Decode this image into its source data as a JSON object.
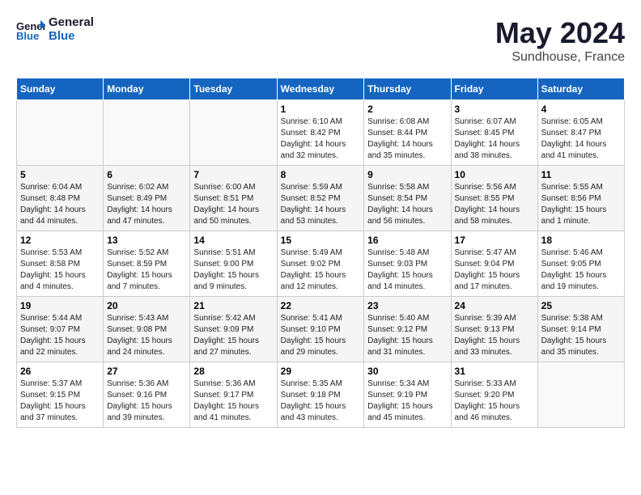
{
  "header": {
    "logo_line1": "General",
    "logo_line2": "Blue",
    "month_title": "May 2024",
    "subtitle": "Sundhouse, France"
  },
  "days_of_week": [
    "Sunday",
    "Monday",
    "Tuesday",
    "Wednesday",
    "Thursday",
    "Friday",
    "Saturday"
  ],
  "weeks": [
    [
      {
        "day": "",
        "sunrise": "",
        "sunset": "",
        "daylight": ""
      },
      {
        "day": "",
        "sunrise": "",
        "sunset": "",
        "daylight": ""
      },
      {
        "day": "",
        "sunrise": "",
        "sunset": "",
        "daylight": ""
      },
      {
        "day": "1",
        "sunrise": "Sunrise: 6:10 AM",
        "sunset": "Sunset: 8:42 PM",
        "daylight": "Daylight: 14 hours and 32 minutes."
      },
      {
        "day": "2",
        "sunrise": "Sunrise: 6:08 AM",
        "sunset": "Sunset: 8:44 PM",
        "daylight": "Daylight: 14 hours and 35 minutes."
      },
      {
        "day": "3",
        "sunrise": "Sunrise: 6:07 AM",
        "sunset": "Sunset: 8:45 PM",
        "daylight": "Daylight: 14 hours and 38 minutes."
      },
      {
        "day": "4",
        "sunrise": "Sunrise: 6:05 AM",
        "sunset": "Sunset: 8:47 PM",
        "daylight": "Daylight: 14 hours and 41 minutes."
      }
    ],
    [
      {
        "day": "5",
        "sunrise": "Sunrise: 6:04 AM",
        "sunset": "Sunset: 8:48 PM",
        "daylight": "Daylight: 14 hours and 44 minutes."
      },
      {
        "day": "6",
        "sunrise": "Sunrise: 6:02 AM",
        "sunset": "Sunset: 8:49 PM",
        "daylight": "Daylight: 14 hours and 47 minutes."
      },
      {
        "day": "7",
        "sunrise": "Sunrise: 6:00 AM",
        "sunset": "Sunset: 8:51 PM",
        "daylight": "Daylight: 14 hours and 50 minutes."
      },
      {
        "day": "8",
        "sunrise": "Sunrise: 5:59 AM",
        "sunset": "Sunset: 8:52 PM",
        "daylight": "Daylight: 14 hours and 53 minutes."
      },
      {
        "day": "9",
        "sunrise": "Sunrise: 5:58 AM",
        "sunset": "Sunset: 8:54 PM",
        "daylight": "Daylight: 14 hours and 56 minutes."
      },
      {
        "day": "10",
        "sunrise": "Sunrise: 5:56 AM",
        "sunset": "Sunset: 8:55 PM",
        "daylight": "Daylight: 14 hours and 58 minutes."
      },
      {
        "day": "11",
        "sunrise": "Sunrise: 5:55 AM",
        "sunset": "Sunset: 8:56 PM",
        "daylight": "Daylight: 15 hours and 1 minute."
      }
    ],
    [
      {
        "day": "12",
        "sunrise": "Sunrise: 5:53 AM",
        "sunset": "Sunset: 8:58 PM",
        "daylight": "Daylight: 15 hours and 4 minutes."
      },
      {
        "day": "13",
        "sunrise": "Sunrise: 5:52 AM",
        "sunset": "Sunset: 8:59 PM",
        "daylight": "Daylight: 15 hours and 7 minutes."
      },
      {
        "day": "14",
        "sunrise": "Sunrise: 5:51 AM",
        "sunset": "Sunset: 9:00 PM",
        "daylight": "Daylight: 15 hours and 9 minutes."
      },
      {
        "day": "15",
        "sunrise": "Sunrise: 5:49 AM",
        "sunset": "Sunset: 9:02 PM",
        "daylight": "Daylight: 15 hours and 12 minutes."
      },
      {
        "day": "16",
        "sunrise": "Sunrise: 5:48 AM",
        "sunset": "Sunset: 9:03 PM",
        "daylight": "Daylight: 15 hours and 14 minutes."
      },
      {
        "day": "17",
        "sunrise": "Sunrise: 5:47 AM",
        "sunset": "Sunset: 9:04 PM",
        "daylight": "Daylight: 15 hours and 17 minutes."
      },
      {
        "day": "18",
        "sunrise": "Sunrise: 5:46 AM",
        "sunset": "Sunset: 9:05 PM",
        "daylight": "Daylight: 15 hours and 19 minutes."
      }
    ],
    [
      {
        "day": "19",
        "sunrise": "Sunrise: 5:44 AM",
        "sunset": "Sunset: 9:07 PM",
        "daylight": "Daylight: 15 hours and 22 minutes."
      },
      {
        "day": "20",
        "sunrise": "Sunrise: 5:43 AM",
        "sunset": "Sunset: 9:08 PM",
        "daylight": "Daylight: 15 hours and 24 minutes."
      },
      {
        "day": "21",
        "sunrise": "Sunrise: 5:42 AM",
        "sunset": "Sunset: 9:09 PM",
        "daylight": "Daylight: 15 hours and 27 minutes."
      },
      {
        "day": "22",
        "sunrise": "Sunrise: 5:41 AM",
        "sunset": "Sunset: 9:10 PM",
        "daylight": "Daylight: 15 hours and 29 minutes."
      },
      {
        "day": "23",
        "sunrise": "Sunrise: 5:40 AM",
        "sunset": "Sunset: 9:12 PM",
        "daylight": "Daylight: 15 hours and 31 minutes."
      },
      {
        "day": "24",
        "sunrise": "Sunrise: 5:39 AM",
        "sunset": "Sunset: 9:13 PM",
        "daylight": "Daylight: 15 hours and 33 minutes."
      },
      {
        "day": "25",
        "sunrise": "Sunrise: 5:38 AM",
        "sunset": "Sunset: 9:14 PM",
        "daylight": "Daylight: 15 hours and 35 minutes."
      }
    ],
    [
      {
        "day": "26",
        "sunrise": "Sunrise: 5:37 AM",
        "sunset": "Sunset: 9:15 PM",
        "daylight": "Daylight: 15 hours and 37 minutes."
      },
      {
        "day": "27",
        "sunrise": "Sunrise: 5:36 AM",
        "sunset": "Sunset: 9:16 PM",
        "daylight": "Daylight: 15 hours and 39 minutes."
      },
      {
        "day": "28",
        "sunrise": "Sunrise: 5:36 AM",
        "sunset": "Sunset: 9:17 PM",
        "daylight": "Daylight: 15 hours and 41 minutes."
      },
      {
        "day": "29",
        "sunrise": "Sunrise: 5:35 AM",
        "sunset": "Sunset: 9:18 PM",
        "daylight": "Daylight: 15 hours and 43 minutes."
      },
      {
        "day": "30",
        "sunrise": "Sunrise: 5:34 AM",
        "sunset": "Sunset: 9:19 PM",
        "daylight": "Daylight: 15 hours and 45 minutes."
      },
      {
        "day": "31",
        "sunrise": "Sunrise: 5:33 AM",
        "sunset": "Sunset: 9:20 PM",
        "daylight": "Daylight: 15 hours and 46 minutes."
      },
      {
        "day": "",
        "sunrise": "",
        "sunset": "",
        "daylight": ""
      }
    ]
  ]
}
